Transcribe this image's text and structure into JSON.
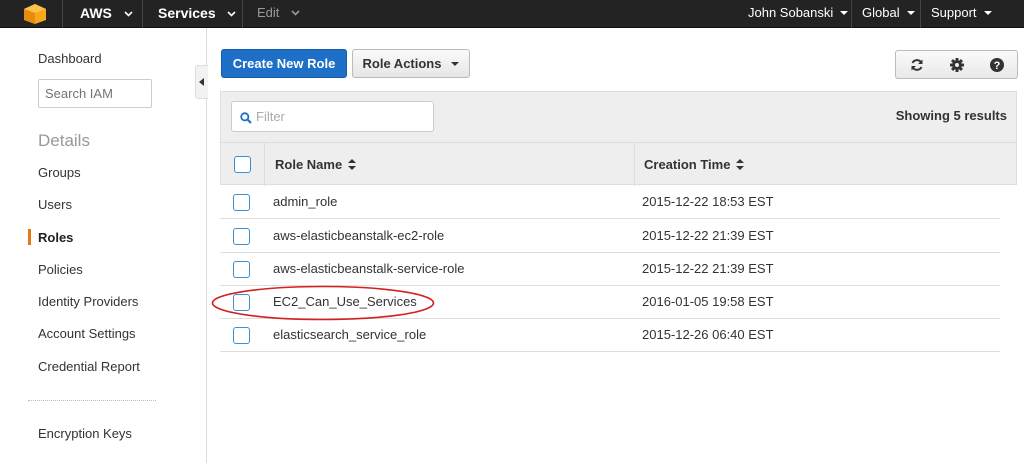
{
  "topbar": {
    "brand": "AWS",
    "services": "Services",
    "edit": "Edit",
    "user": "John Sobanski",
    "region": "Global",
    "support": "Support"
  },
  "sidebar": {
    "dashboard": "Dashboard",
    "search_placeholder": "Search IAM",
    "section_title": "Details",
    "items": [
      {
        "label": "Groups"
      },
      {
        "label": "Users"
      },
      {
        "label": "Roles"
      },
      {
        "label": "Policies"
      },
      {
        "label": "Identity Providers"
      },
      {
        "label": "Account Settings"
      },
      {
        "label": "Credential Report"
      }
    ],
    "active_item": "Roles",
    "encryption": "Encryption Keys"
  },
  "toolbar": {
    "create_label": "Create New Role",
    "actions_label": "Role Actions"
  },
  "results": {
    "filter_placeholder": "Filter",
    "showing": "Showing 5 results",
    "columns": {
      "name": "Role Name",
      "time": "Creation Time"
    },
    "rows": [
      {
        "name": "admin_role",
        "time": "2015-12-22 18:53 EST"
      },
      {
        "name": "aws-elasticbeanstalk-ec2-role",
        "time": "2015-12-22 21:39 EST"
      },
      {
        "name": "aws-elasticbeanstalk-service-role",
        "time": "2015-12-22 21:39 EST"
      },
      {
        "name": "EC2_Can_Use_Services",
        "time": "2016-01-05 19:58 EST"
      },
      {
        "name": "elasticsearch_service_role",
        "time": "2015-12-26 06:40 EST"
      }
    ]
  },
  "icons": {
    "refresh": "refresh-icon",
    "settings": "gear-icon",
    "help": "help-icon"
  },
  "colors": {
    "primary": "#1d6fc7",
    "active_accent": "#e47911",
    "annotation": "#d42020",
    "checkbox_border": "#3d8fd1"
  }
}
